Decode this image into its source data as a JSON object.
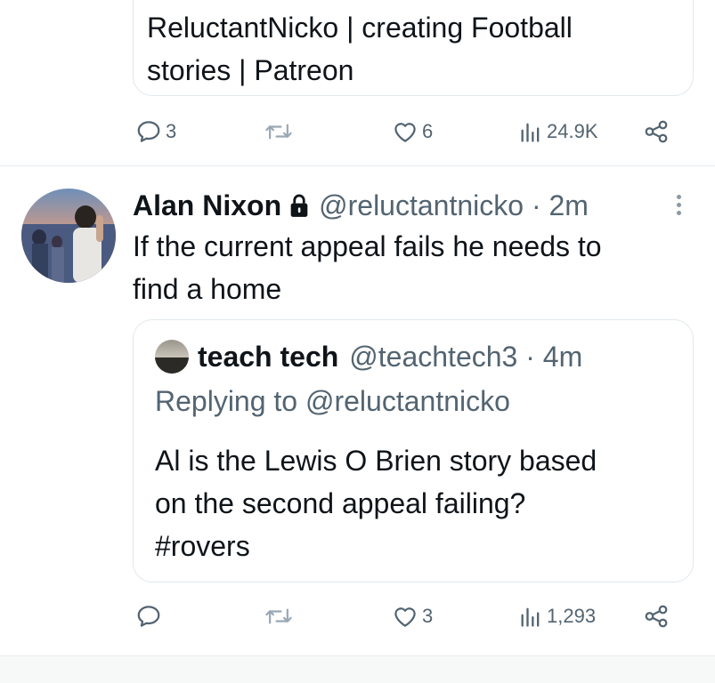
{
  "top_card": {
    "lines": [
      "ReluctantNicko | creating Football",
      "stories | Patreon"
    ]
  },
  "top_actions": {
    "reply_count": "3",
    "retweet_count": "",
    "like_count": "6",
    "views_count": "24.9K"
  },
  "tweet": {
    "name": "Alan Nixon",
    "handle_time": "@reluctantnicko · 2m",
    "text_lines": [
      "If the current appeal fails he needs to",
      "find a home"
    ],
    "quote": {
      "name": "teach tech",
      "handle_time": "@teachtech3 · 4m",
      "replying_to": "Replying to @reluctantnicko",
      "text_lines": [
        "Al is the Lewis O Brien story based",
        "on the second appeal failing?",
        "#rovers"
      ]
    },
    "actions": {
      "reply_count": "",
      "retweet_count": "",
      "like_count": "3",
      "views_count": "1,293"
    }
  },
  "colors": {
    "text": "#0f1419",
    "secondary": "#536471",
    "border": "#e1e8ed"
  },
  "icons": [
    "reply-icon",
    "retweet-icon",
    "like-icon",
    "views-icon",
    "share-icon",
    "lock-icon",
    "more-icon"
  ]
}
